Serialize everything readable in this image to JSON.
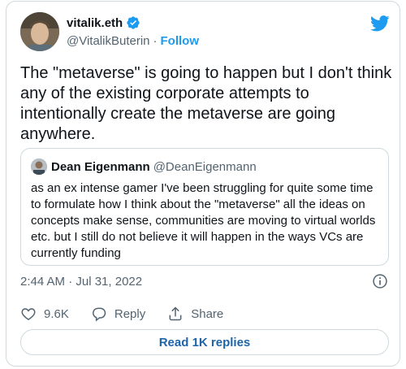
{
  "author": {
    "display_name": "vitalik.eth",
    "handle": "@VitalikButerin",
    "separator": "·",
    "follow_label": "Follow",
    "verified": true
  },
  "tweet": {
    "text": "The \"metaverse\" is going to happen but I don't think any of the existing corporate attempts to intentionally create the metaverse are going anywhere."
  },
  "quoted_tweet": {
    "display_name": "Dean Eigenmann",
    "handle": "@DeanEigenmann",
    "text": "as an ex intense gamer I've been struggling for quite some time to formulate how I think about the \"metaverse\" all the ideas on concepts make sense, communities are moving to virtual worlds etc. but I still do not believe it will happen in the ways VCs are currently funding"
  },
  "timestamp": "2:44 AM · Jul 31, 2022",
  "actions": {
    "like_count": "9.6K",
    "reply_label": "Reply",
    "share_label": "Share"
  },
  "read_replies_label": "Read 1K replies",
  "colors": {
    "accent": "#1d9bf0",
    "text": "#0f1419",
    "muted": "#536471",
    "border": "#cfd9de",
    "link_dark": "#1d64a8"
  },
  "icons": {
    "brand": "twitter-bird-icon",
    "verified": "verified-badge-icon",
    "info": "info-icon",
    "like": "heart-icon",
    "reply": "speech-bubble-icon",
    "share": "share-upload-icon"
  }
}
